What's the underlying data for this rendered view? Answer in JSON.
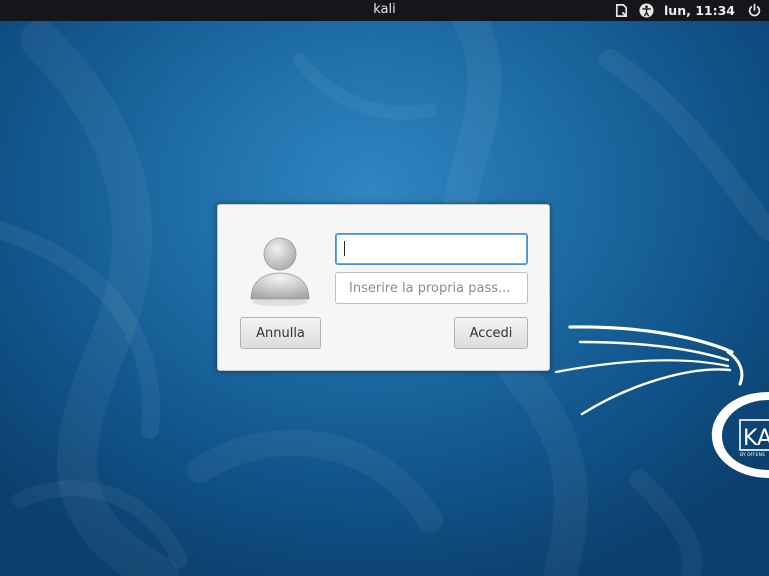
{
  "topbar": {
    "hostname": "kali",
    "clock": "lun, 11:34",
    "icons": [
      "keyboard-icon",
      "accessibility-icon",
      "power-icon"
    ]
  },
  "login": {
    "username_value": "",
    "password_placeholder": "Inserire la propria pass...",
    "cancel_label": "Annulla",
    "login_label": "Accedi"
  },
  "branding": {
    "logo_text": "KA",
    "logo_subtext": "BY OFFENS"
  },
  "colors": {
    "desktop_blue": "#1f6ea8",
    "topbar": "#14161a",
    "focus_blue": "#4a90d9"
  }
}
